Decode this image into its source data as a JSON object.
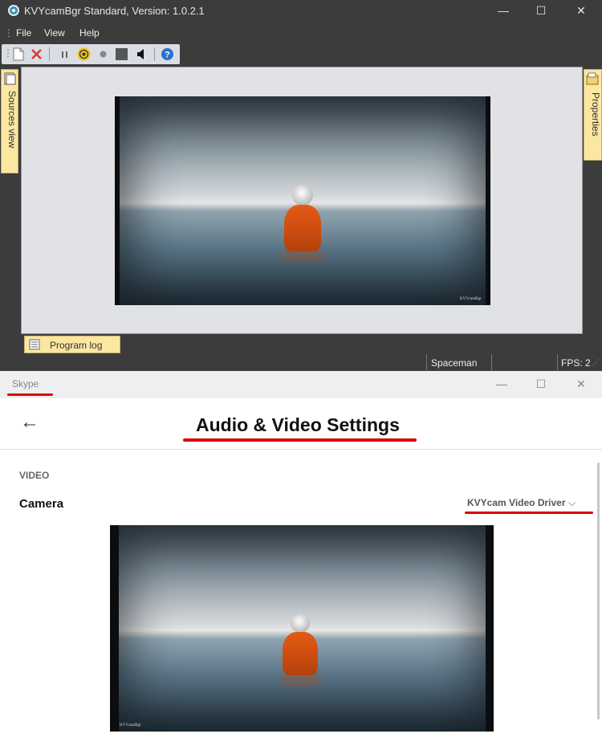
{
  "kvycam": {
    "window_title": "KVYcamBgr Standard, Version: 1.0.2.1",
    "window_controls": {
      "minimize": "—",
      "maximize": "☐",
      "close": "✕"
    },
    "menu": [
      "File",
      "View",
      "Help"
    ],
    "toolbar_icons": [
      "new-icon",
      "delete-icon",
      "pause-icon",
      "broadcast-icon",
      "record-icon",
      "stop-icon",
      "speaker-icon",
      "help-icon"
    ],
    "sources_tab": "Sources view",
    "properties_tab": "Properties",
    "program_log_tab": "Program log",
    "preview_watermark": "KVYcamBgr",
    "status": {
      "source": "Spaceman",
      "fps": "FPS: 2"
    }
  },
  "skype": {
    "window_title": "Skype",
    "window_controls": {
      "minimize": "—",
      "maximize": "☐",
      "close": "✕"
    },
    "back_icon": "←",
    "page_title": "Audio & Video Settings",
    "section": "VIDEO",
    "camera_label": "Camera",
    "camera_value": "KVYcam Video Driver",
    "preview_watermark": "KVYcamBgr",
    "annotation_color": "#dd0000"
  }
}
